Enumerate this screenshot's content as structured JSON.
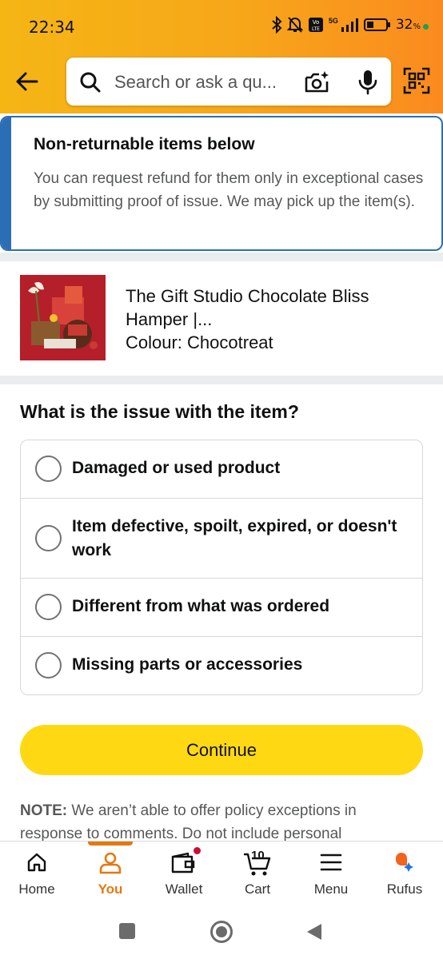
{
  "status_bar": {
    "time": "22:34",
    "network_label": "5G",
    "volte_label": "Vo LTE",
    "battery_percent": "32",
    "battery_unit": "%"
  },
  "header": {
    "search_placeholder": "Search or ask a qu...",
    "icons": [
      "back-arrow-icon",
      "search-icon",
      "camera-sparkle-icon",
      "microphone-icon",
      "qr-scan-icon"
    ]
  },
  "banner": {
    "title": "Non-returnable items below",
    "body": "You can request refund for them only in exceptional cases by submitting proof of issue. We may pick up the item(s)."
  },
  "product": {
    "title": "The Gift Studio Chocolate Bliss Hamper |...",
    "colour": "Colour: Chocotreat"
  },
  "issue": {
    "question": "What is the issue with the item?",
    "options": [
      "Damaged or used product",
      "Item defective, spoilt, expired, or doesn't work",
      "Different from what was ordered",
      "Missing parts or accessories"
    ]
  },
  "continue_label": "Continue",
  "note": {
    "prefix": "NOTE:",
    "text": " We aren’t able to offer policy exceptions in response to comments. Do not include personal"
  },
  "bottom_nav": {
    "items": [
      "Home",
      "You",
      "Wallet",
      "Cart",
      "Menu",
      "Rufus"
    ],
    "active": "You",
    "cart_count": "10",
    "accent_color": "#e47911"
  },
  "colors": {
    "header_gradient_start": "#f5b614",
    "header_gradient_end": "#fb8a1f",
    "banner_accent": "#2c6eb5",
    "button_yellow": "#ffd814"
  }
}
